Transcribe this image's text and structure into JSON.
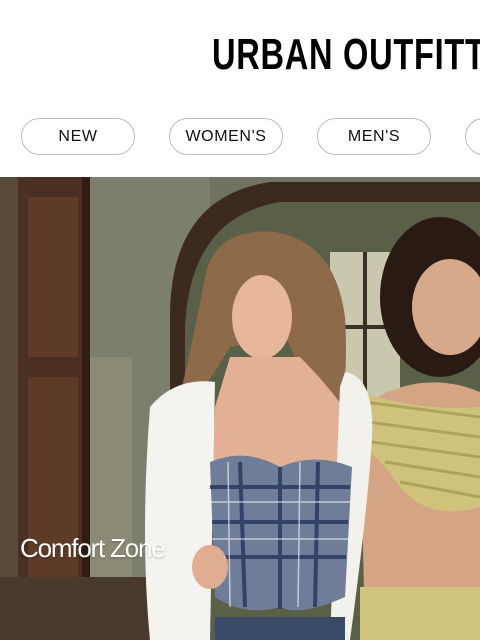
{
  "header": {
    "logo_text": "URBAN OUTFITTERS"
  },
  "nav": {
    "items": [
      {
        "label": "NEW"
      },
      {
        "label": "WOMEN'S"
      },
      {
        "label": "MEN'S"
      },
      {
        "label": ""
      }
    ]
  },
  "hero": {
    "caption": "Comfort Zone"
  },
  "colors": {
    "pill_border": "#bdbdbd",
    "text": "#111111",
    "caption": "#ffffff"
  }
}
